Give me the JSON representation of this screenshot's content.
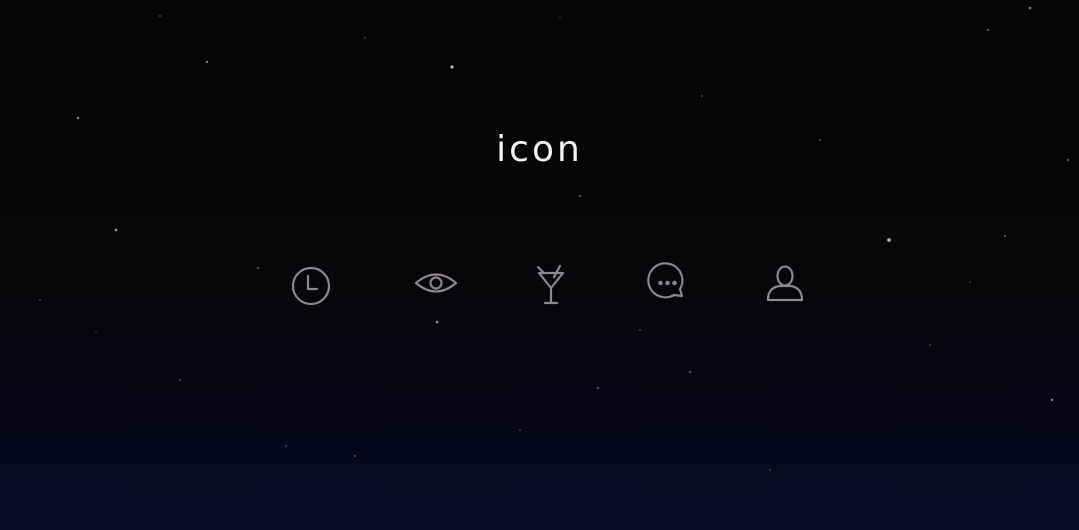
{
  "heading": "icon",
  "icon_color": "#8d8494",
  "icons": [
    {
      "name": "clock-icon"
    },
    {
      "name": "eye-icon"
    },
    {
      "name": "cocktail-glass-icon"
    },
    {
      "name": "chat-bubble-icon"
    },
    {
      "name": "user-icon"
    }
  ]
}
